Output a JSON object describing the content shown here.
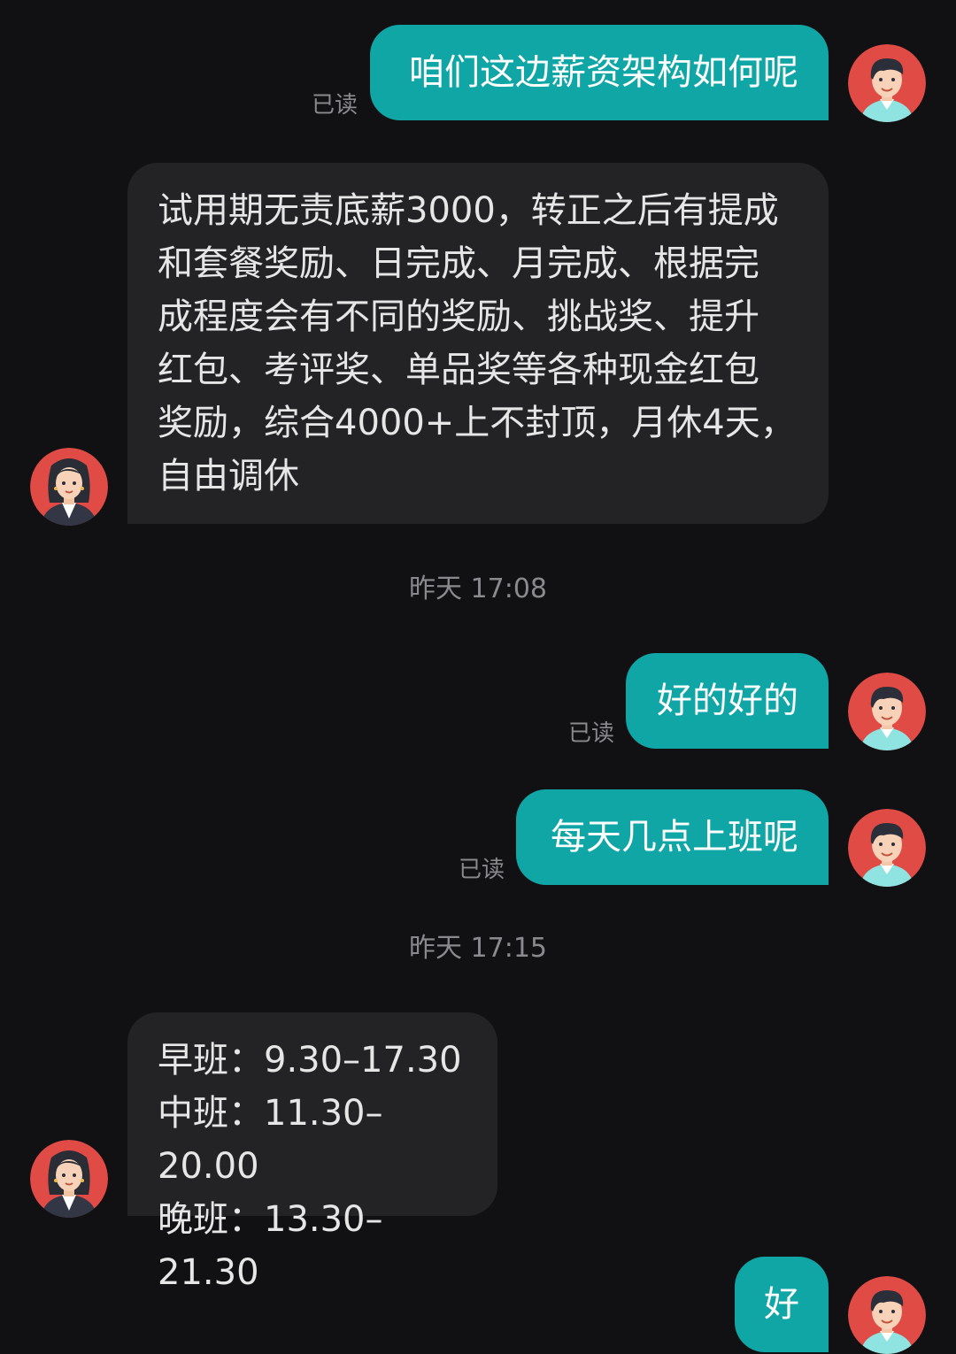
{
  "messages": [
    {
      "id": "m1",
      "from": "me",
      "text": "咱们这边薪资架构如何呢",
      "status": "已读"
    },
    {
      "id": "m2",
      "from": "other",
      "lines": [
        "试用期无责底薪3000，转正之后有提成",
        "和套餐奖励、日完成、月完成、根据完",
        "成程度会有不同的奖励、挑战奖、提升",
        "红包、考评奖、单品奖等各种现金红包",
        "奖励，综合4000+上不封顶，月休4天，",
        "自由调休"
      ]
    },
    {
      "id": "t1",
      "type": "timestamp",
      "text": "昨天 17:08"
    },
    {
      "id": "m3",
      "from": "me",
      "text": "好的好的",
      "status": "已读"
    },
    {
      "id": "m4",
      "from": "me",
      "text": "每天几点上班呢",
      "status": "已读"
    },
    {
      "id": "t2",
      "type": "timestamp",
      "text": "昨天 17:15"
    },
    {
      "id": "m5",
      "from": "other",
      "lines": [
        "早班：9.30–17.30",
        "中班：11.30–20.00",
        "晚班：13.30–21.30"
      ]
    },
    {
      "id": "m6",
      "from": "me",
      "text": "好"
    }
  ],
  "colors": {
    "background": "#111114",
    "outgoing_bubble": "#10a6a6",
    "incoming_bubble": "#232326",
    "meta_text": "#8a8a8e",
    "avatar_bg": "#e04b45"
  },
  "icons": {
    "me_avatar": "male-avatar-icon",
    "other_avatar": "female-avatar-icon"
  }
}
